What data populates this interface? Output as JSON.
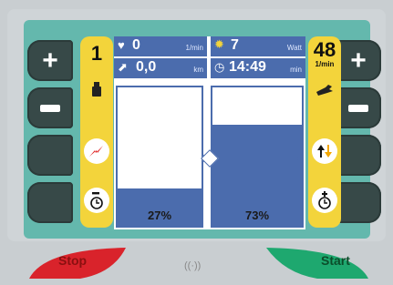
{
  "left_panel": {
    "level_value": "1",
    "icons": [
      "weight-icon",
      "lightning-icon",
      "timer-minus-icon"
    ]
  },
  "right_panel": {
    "cadence_value": "48",
    "cadence_unit": "1/min",
    "icons": [
      "wrench-icon",
      "updown-icon",
      "timer-plus-icon"
    ]
  },
  "display": {
    "heart_rate": {
      "value": "0",
      "unit": "1/min"
    },
    "power": {
      "value": "7",
      "unit": "Watt"
    },
    "distance": {
      "value": "0,0",
      "unit": "km"
    },
    "time": {
      "value": "14:49",
      "unit": "min"
    }
  },
  "meters": {
    "left_percent_label": "27%",
    "right_percent_label": "73%",
    "left_level": 0.27,
    "right_level": 0.73
  },
  "buttons": {
    "stop_label": "Stop",
    "start_label": "Start"
  },
  "side_buttons": {
    "plus_symbol": "+"
  },
  "center_mark": "((·))",
  "colors": {
    "panel": "#64b8ad",
    "display_blue": "#4b6cad",
    "accent_yellow": "#f3d43b",
    "stop_red": "#d9232b",
    "start_green": "#1ea86f"
  }
}
